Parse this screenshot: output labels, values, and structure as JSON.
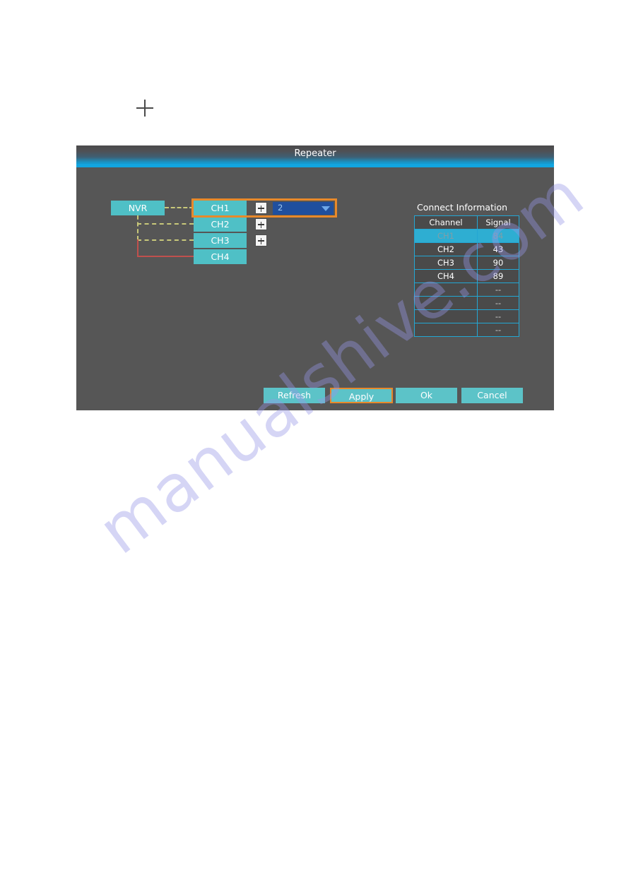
{
  "page": {
    "background_color": "#ffffff",
    "plus_mark": "+",
    "watermark_text": "manualshive.com"
  },
  "dialog": {
    "title": "Repeater",
    "accent_color": "#12a5e0",
    "body_color": "#565656",
    "highlight_color": "#e8892a"
  },
  "topology": {
    "root_label": "NVR",
    "channels": [
      {
        "label": "CH1",
        "link": "dashed-yellow",
        "has_add_button": true,
        "selected": true
      },
      {
        "label": "CH2",
        "link": "dashed-yellow",
        "has_add_button": true,
        "selected": false
      },
      {
        "label": "CH3",
        "link": "dashed-yellow",
        "has_add_button": true,
        "selected": false
      },
      {
        "label": "CH4",
        "link": "solid-red",
        "has_add_button": false,
        "selected": false
      }
    ],
    "add_button_icon": "plus-icon",
    "node_color": "#4fc0c6",
    "dashed_link_color": "#c8c87a",
    "solid_link_color": "#c0504d"
  },
  "repeater_select": {
    "value": "2",
    "arrow_icon": "chevron-down-icon",
    "background_color": "#1f4f9e"
  },
  "connect_information": {
    "title": "Connect Information",
    "columns": [
      "Channel",
      "Signal"
    ],
    "rows": [
      {
        "channel": "CH1",
        "signal": "84",
        "selected": true
      },
      {
        "channel": "CH2",
        "signal": "43",
        "selected": false
      },
      {
        "channel": "CH3",
        "signal": "90",
        "selected": false
      },
      {
        "channel": "CH4",
        "signal": "89",
        "selected": false
      },
      {
        "channel": "",
        "signal": "--",
        "selected": false
      },
      {
        "channel": "",
        "signal": "--",
        "selected": false
      },
      {
        "channel": "",
        "signal": "--",
        "selected": false
      },
      {
        "channel": "",
        "signal": "--",
        "selected": false
      }
    ],
    "border_color": "#23a7d4",
    "selected_row_color": "#2eaed2"
  },
  "footer": {
    "refresh_label": "Refresh",
    "apply_label": "Apply",
    "ok_label": "Ok",
    "cancel_label": "Cancel",
    "button_color": "#5cc3c8",
    "focused_button": "Apply"
  }
}
